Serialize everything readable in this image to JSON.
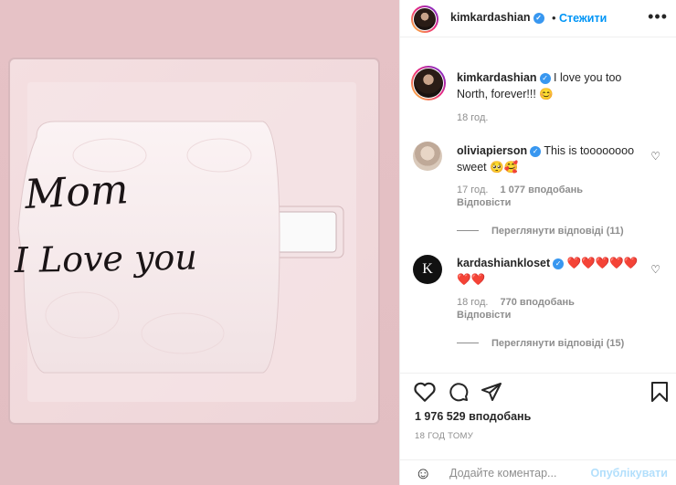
{
  "photo": {
    "handwriting_line1": "Mom",
    "handwriting_line2": "I Love you"
  },
  "header": {
    "username": "kimkardashian",
    "dot": "•",
    "follow_label": "Стежити",
    "more_icon": "more-icon"
  },
  "caption": {
    "username": "kimkardashian",
    "text": "I love you too North, forever!!! 😊",
    "time": "18 год."
  },
  "comments": [
    {
      "username": "oliviapierson",
      "text": "This is toooooooo sweet 🥺🥰",
      "time": "17 год.",
      "likes": "1 077 вподобань",
      "reply_label": "Відповісти",
      "view_replies": "Переглянути відповіді (11)"
    },
    {
      "username": "kardashiankloset",
      "avatar_letter": "K",
      "text": "❤️❤️❤️❤️❤️❤️❤️",
      "time": "18 год.",
      "likes": "770 вподобань",
      "reply_label": "Відповісти",
      "view_replies": "Переглянути відповіді (15)"
    }
  ],
  "actions": {
    "like_icon": "heart-icon",
    "comment_icon": "comment-icon",
    "share_icon": "share-icon",
    "save_icon": "bookmark-icon",
    "likes_count": "1 976 529 вподобань",
    "time_ago": "18 ГОД ТОМУ"
  },
  "add_comment": {
    "placeholder": "Додайте коментар...",
    "post_label": "Опублікувати",
    "emoji_icon": "smile-icon"
  },
  "colors": {
    "accent": "#0095f6",
    "verified": "#3897f0",
    "post_disabled": "#b2dffc",
    "muted_text": "#8e8e8e"
  }
}
